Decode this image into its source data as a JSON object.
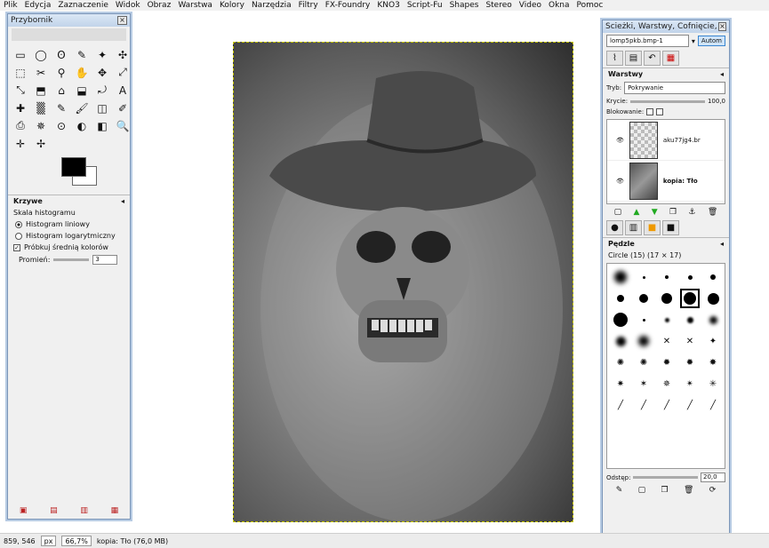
{
  "menu": [
    "Plik",
    "Edycja",
    "Zaznaczenie",
    "Widok",
    "Obraz",
    "Warstwa",
    "Kolory",
    "Narzędzia",
    "Filtry",
    "FX-Foundry",
    "KNO3",
    "Script-Fu",
    "Shapes",
    "Stereo",
    "Video",
    "Okna",
    "Pomoc"
  ],
  "toolbox": {
    "title": "Przybornik",
    "close": "×",
    "tools": [
      "▭",
      "◯",
      "ʘ",
      "✎",
      "✦",
      "✣",
      "⬚",
      "✂",
      "⚲",
      "✋",
      "✥",
      "⤢",
      "⤡",
      "⬒",
      "⌂",
      "⬓",
      "⤾",
      "A",
      "✚",
      "▒",
      "✎",
      "🖌",
      "◫",
      "✐",
      "⎙",
      "✵",
      "⊙",
      "◐",
      "◧",
      "🔍",
      "✛",
      "✢"
    ],
    "curves_title": "Krzywe",
    "histogram_label": "Skala histogramu",
    "linear": "Histogram liniowy",
    "log": "Histogram logarytmiczny",
    "sample_avg": "Próbkuj średnią kolorów",
    "radius_label": "Promień:",
    "radius_value": "3"
  },
  "dock": {
    "title": "Ścieżki, Warstwy, Cofnięcie, Kana...",
    "image_select": "lomp5pkb.bmp-1",
    "auto": "Autom",
    "layers_title": "Warstwy",
    "mode_label": "Tryb:",
    "mode_value": "Pokrywanie",
    "opacity_label": "Krycie:",
    "opacity_value": "100,0",
    "lock_label": "Blokowanie:",
    "layers": [
      {
        "name": "aku77jg4.br",
        "bold": false
      },
      {
        "name": "kopia: Tło",
        "bold": true
      }
    ],
    "brushes_title": "Pędzle",
    "brush_name": "Circle (15) (17 × 17)",
    "spacing_label": "Odstęp:",
    "spacing_value": "20,0"
  },
  "status": {
    "coords": "859, 546",
    "unit": "px",
    "zoom": "66,7%",
    "info": "kopia: Tło (76,0 MB)"
  }
}
